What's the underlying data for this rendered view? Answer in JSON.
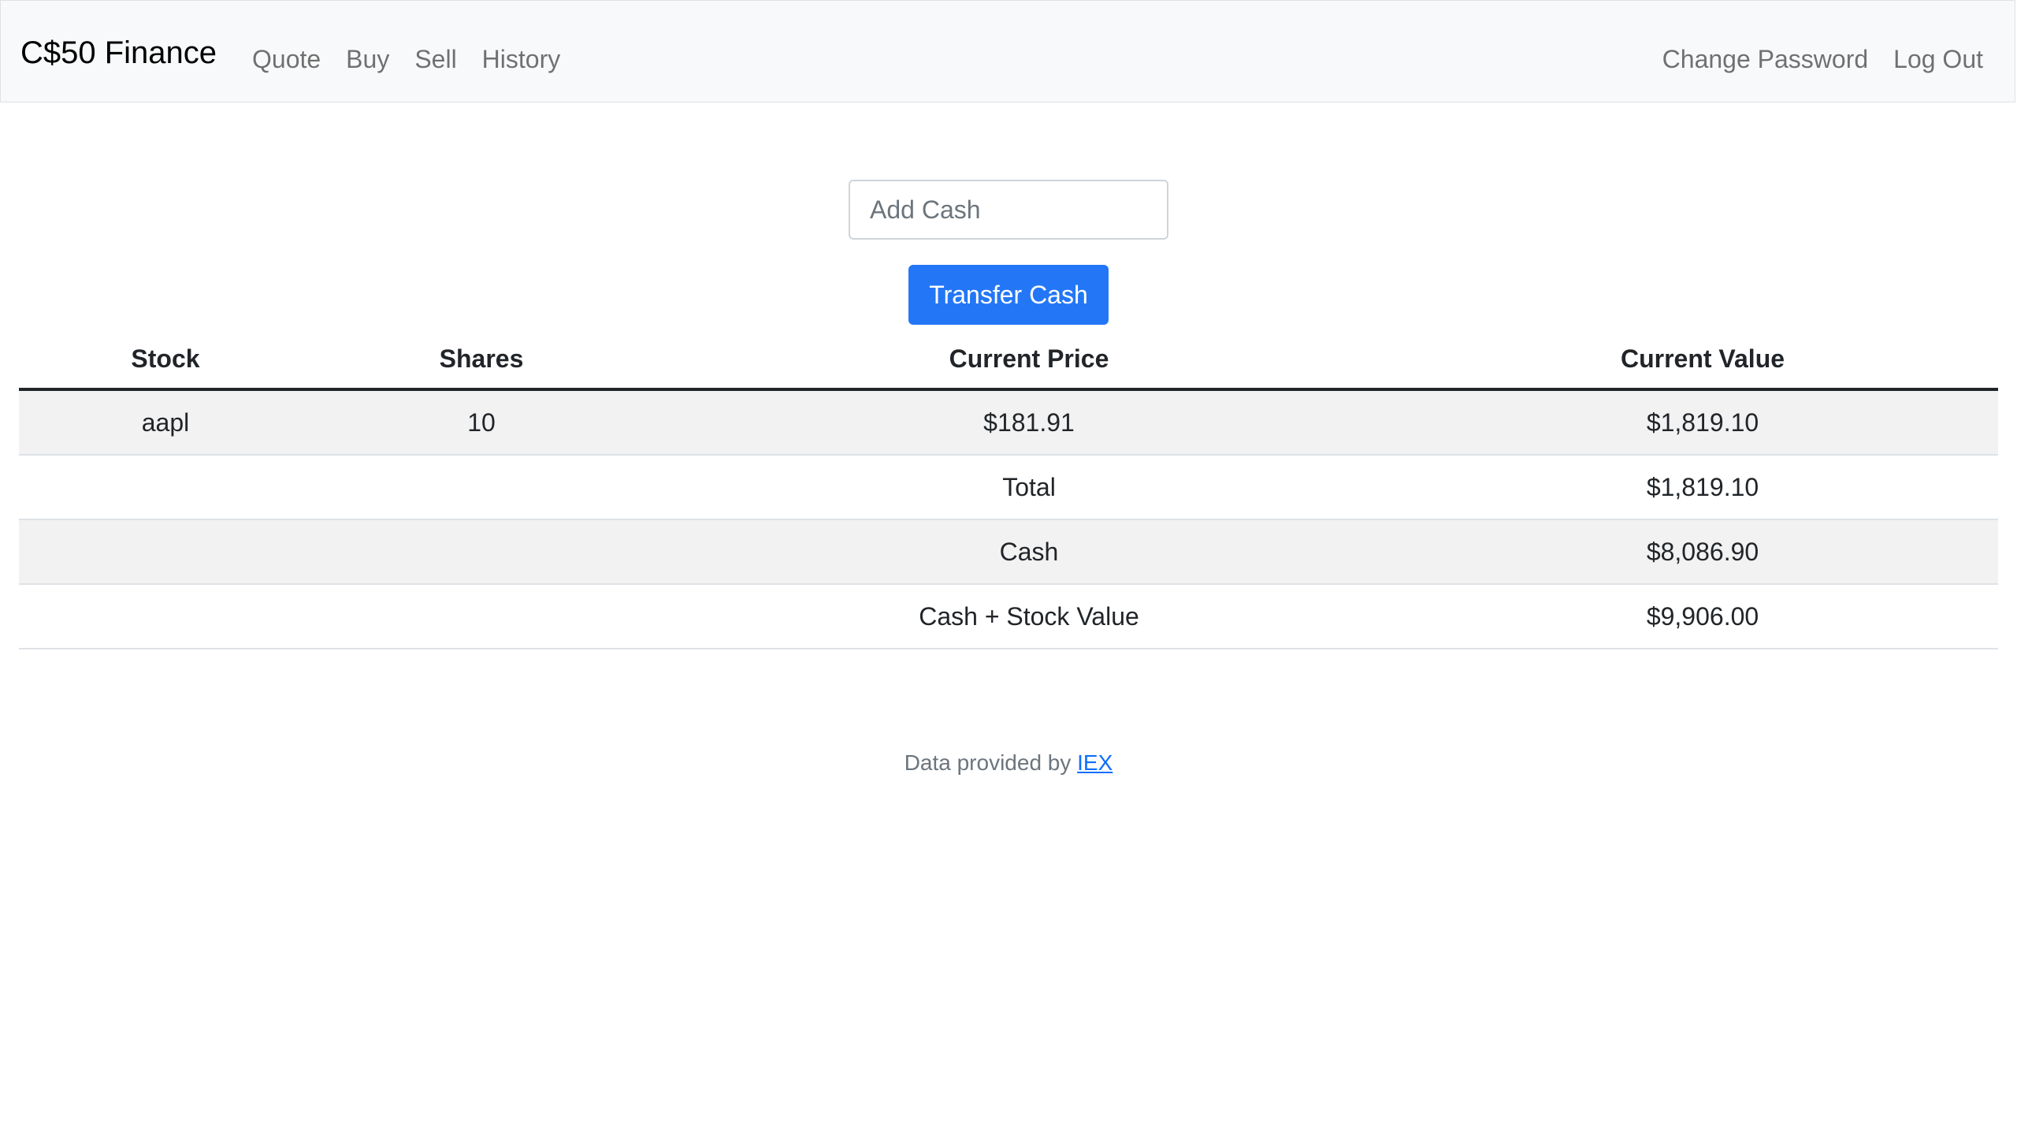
{
  "nav": {
    "brand": "C$50 Finance",
    "links_left": [
      "Quote",
      "Buy",
      "Sell",
      "History"
    ],
    "links_right": [
      "Change Password",
      "Log Out"
    ]
  },
  "cash_form": {
    "input_placeholder": "Add Cash",
    "button_label": "Transfer Cash"
  },
  "table": {
    "headers": [
      "Stock",
      "Shares",
      "Current Price",
      "Current Value"
    ],
    "holdings": [
      {
        "stock": "aapl",
        "shares": "10",
        "price": "$181.91",
        "value": "$1,819.10"
      }
    ],
    "summary": [
      {
        "label": "Total",
        "value": "$1,819.10"
      },
      {
        "label": "Cash",
        "value": "$8,086.90"
      },
      {
        "label": "Cash + Stock Value",
        "value": "$9,906.00"
      }
    ]
  },
  "footer": {
    "prefix": "Data provided by",
    "link_text": "IEX"
  },
  "colors": {
    "primary_button": "#2377f6",
    "navbar_bg": "#f8f9fa",
    "link": "#0d6efd"
  }
}
